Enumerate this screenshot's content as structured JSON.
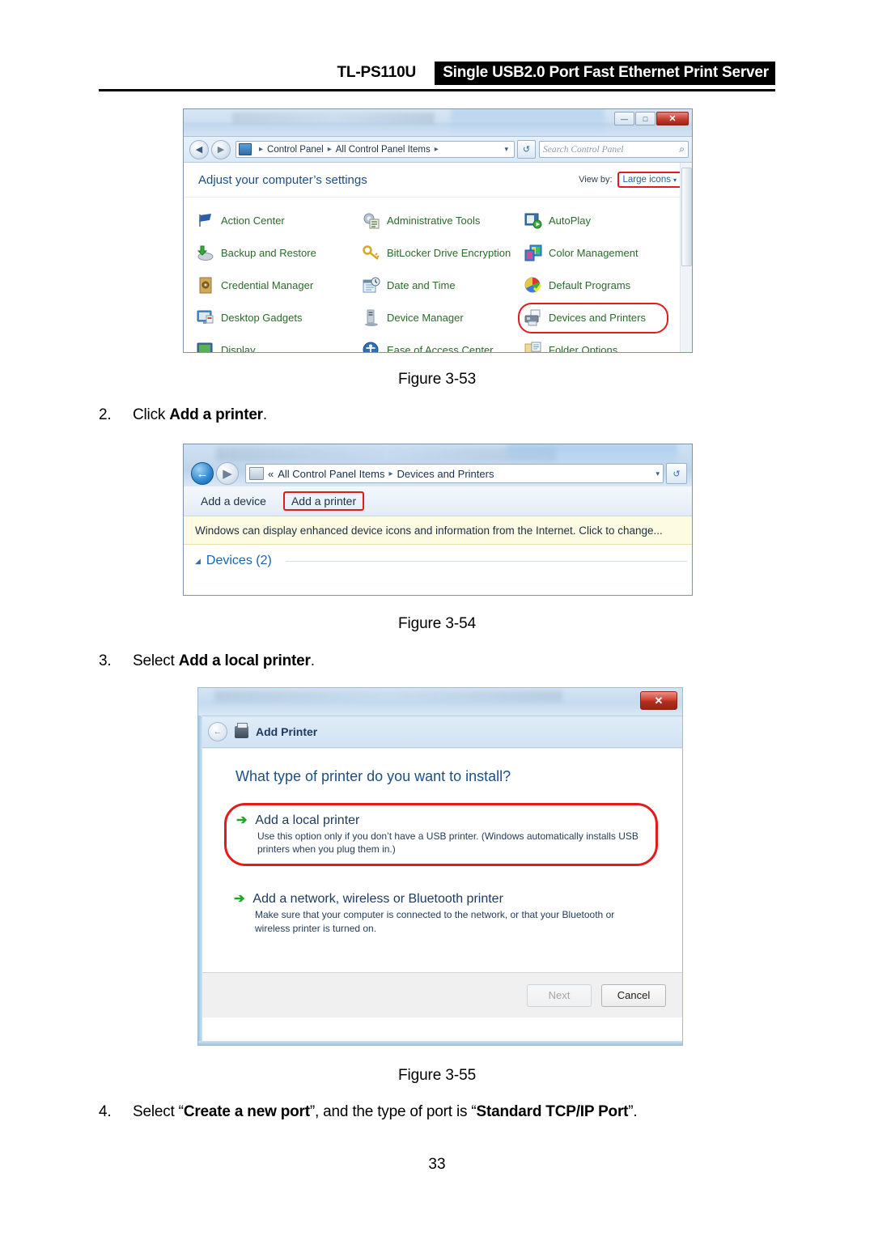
{
  "header": {
    "model": "TL-PS110U",
    "banner": "Single USB2.0 Port Fast Ethernet Print Server"
  },
  "page_number": "33",
  "figures": {
    "fig53": "Figure 3-53",
    "fig54": "Figure 3-54",
    "fig55": "Figure 3-55"
  },
  "steps": {
    "step2": {
      "num": "2.",
      "pre": "Click ",
      "bold": "Add a printer",
      "post": "."
    },
    "step3": {
      "num": "3.",
      "pre": "Select ",
      "bold": "Add a local printer",
      "post": "."
    },
    "step4": {
      "num": "4.",
      "pre": "Select “",
      "bold1": "Create a new port",
      "mid": "”, and the type of port is “",
      "bold2": "Standard TCP/IP Port",
      "post": "”."
    }
  },
  "control_panel": {
    "window_buttons": {
      "minimize": "—",
      "maximize": "□",
      "close": "✕"
    },
    "breadcrumb": {
      "root": "Control Panel",
      "current": "All Control Panel Items",
      "sep": "▸",
      "caret": "▾"
    },
    "refresh_icon": "↺",
    "search_placeholder": "Search Control Panel",
    "search_icon": "⌕",
    "subheading": "Adjust your computer’s settings",
    "view_by_label": "View by:",
    "view_by_value": "Large icons",
    "view_by_caret": "▾",
    "items": [
      {
        "label": "Action Center",
        "column": 1
      },
      {
        "label": "Administrative Tools",
        "column": 2
      },
      {
        "label": "AutoPlay",
        "column": 3
      },
      {
        "label": "Backup and Restore",
        "column": 1
      },
      {
        "label": "BitLocker Drive Encryption",
        "column": 2
      },
      {
        "label": "Color Management",
        "column": 3
      },
      {
        "label": "Credential Manager",
        "column": 1
      },
      {
        "label": "Date and Time",
        "column": 2
      },
      {
        "label": "Default Programs",
        "column": 3
      },
      {
        "label": "Desktop Gadgets",
        "column": 1
      },
      {
        "label": "Device Manager",
        "column": 2
      },
      {
        "label": "Devices and Printers",
        "column": 3,
        "highlighted": true
      },
      {
        "label": "Display",
        "column": 1
      },
      {
        "label": "Ease of Access Center",
        "column": 2
      },
      {
        "label": "Folder Options",
        "column": 3
      }
    ],
    "highlight_color": "#e41b1b",
    "link_color": "#2a6a2a"
  },
  "devices_printers": {
    "back_icon": "←",
    "forward_icon": "▼",
    "breadcrumb": {
      "chevrons": "«",
      "root": "All Control Panel Items",
      "sep": "▸",
      "current": "Devices and Printers",
      "caret": "▾"
    },
    "refresh_icon": "↺",
    "toolbar": {
      "add_device": "Add a device",
      "add_printer": "Add a printer"
    },
    "info_bar": "Windows can display enhanced device icons and information from the Internet. Click to change...",
    "section": {
      "triangle": "◢",
      "label": "Devices (2)"
    }
  },
  "add_printer": {
    "close_label": "✕",
    "back_icon": "←",
    "title": "Add Printer",
    "heading": "What type of printer do you want to install?",
    "options": [
      {
        "arrow": "➔",
        "title": "Add a local printer",
        "description": "Use this option only if you don’t have a USB printer. (Windows automatically installs USB printers when you plug them in.)",
        "highlighted": true
      },
      {
        "arrow": "➔",
        "title": "Add a network, wireless or Bluetooth printer",
        "description": "Make sure that your computer is connected to the network, or that your Bluetooth or wireless printer is turned on.",
        "highlighted": false
      }
    ],
    "buttons": {
      "next": "Next",
      "cancel": "Cancel"
    }
  }
}
